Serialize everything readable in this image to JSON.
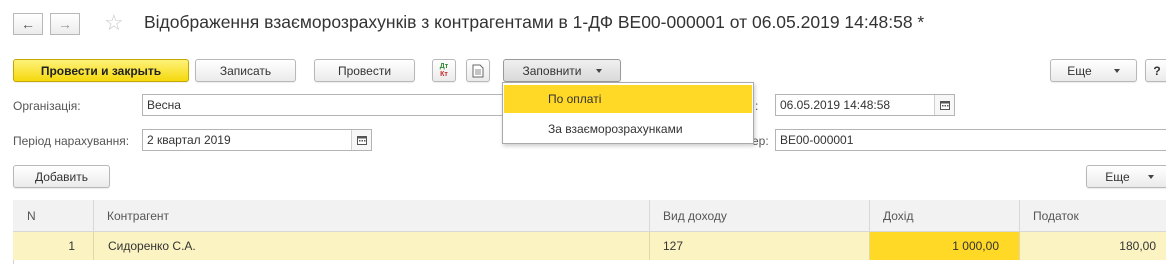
{
  "header": {
    "back_glyph": "←",
    "forward_glyph": "→",
    "star_glyph": "☆",
    "title": "Відображення взаєморозрахунків з контрагентами в 1-ДФ BE00-000001 от 06.05.2019 14:48:58 *"
  },
  "toolbar": {
    "post_close": "Провести и закрыть",
    "write": "Записать",
    "post": "Провести",
    "dtkt_top": "Дт",
    "dtkt_bottom": "Кт",
    "fill": "Заповнити",
    "more": "Еще",
    "help": "?"
  },
  "fill_menu": {
    "items": [
      "По оплаті",
      "За взаєморозрахунками"
    ]
  },
  "form": {
    "org_label": "Організація:",
    "org_value": "Весна",
    "period_label": "Період нарахування:",
    "period_value": "2 квартал 2019",
    "date_label_tail": ":",
    "date_value": "06.05.2019 14:48:58",
    "number_label_tail": "ер:",
    "number_value": "BE00-000001"
  },
  "table_toolbar": {
    "add": "Добавить",
    "more": "Еще"
  },
  "table": {
    "columns": [
      "N",
      "Контрагент",
      "Вид доходу",
      "Дохід",
      "Податок"
    ],
    "rows": [
      {
        "n": "1",
        "counterparty": "Сидоренко С.А.",
        "income_type": "127",
        "income": "1 000,00",
        "tax": "180,00"
      }
    ]
  },
  "colors": {
    "accent_yellow": "#f5d80d",
    "menu_highlight": "#ffd926",
    "row_highlight": "#fbf4c2",
    "active_cell": "#ffd926"
  }
}
